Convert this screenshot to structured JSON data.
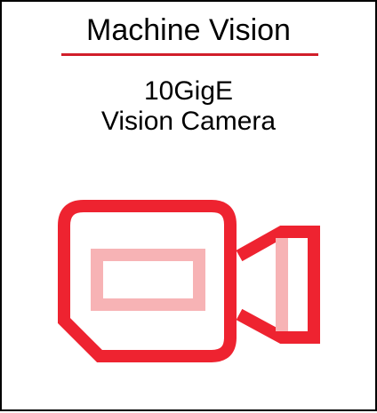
{
  "card": {
    "title": "Machine Vision",
    "subtitle_line1": "10GigE",
    "subtitle_line2": "Vision Camera"
  },
  "icon": {
    "name": "video-camera-icon",
    "stroke_color": "#ee2330",
    "accent_color": "#f7b3b5"
  },
  "colors": {
    "divider": "#d11f2a",
    "border": "#000000",
    "text": "#000000",
    "background": "#ffffff"
  }
}
